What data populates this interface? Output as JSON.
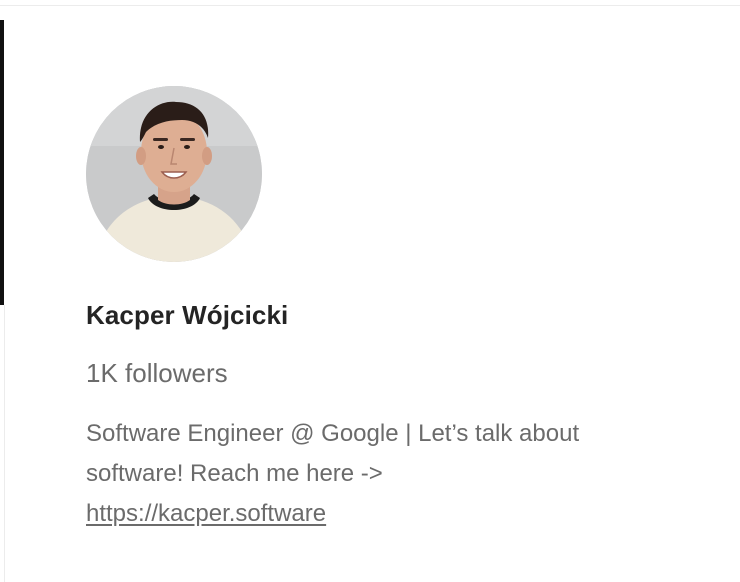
{
  "profile": {
    "name": "Kacper Wójcicki",
    "followers": "1K followers",
    "bio_line1": "Software Engineer @ Google | Let’s talk about",
    "bio_line2": "software! Reach me here ->",
    "link": "https://kacper.software"
  },
  "colors": {
    "name_text": "#242424",
    "muted_text": "#6b6b6b",
    "background": "#ffffff"
  },
  "icons": {
    "avatar": "profile-photo"
  }
}
